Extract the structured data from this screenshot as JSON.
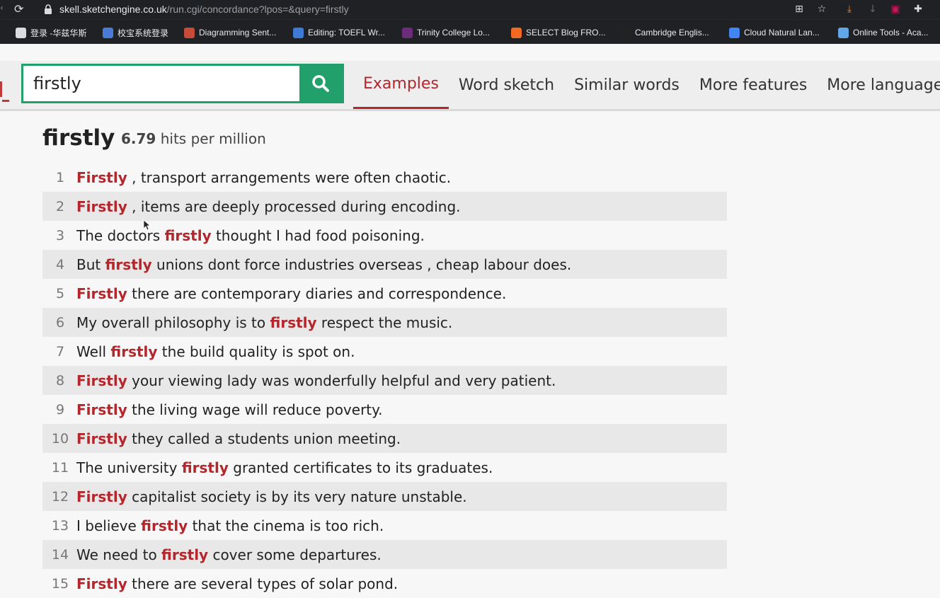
{
  "browser": {
    "url_host": "skell.sketchengine.co.uk",
    "url_path": "/run.cgi/concordance?lpos=&query=firstly",
    "bookmarks": [
      {
        "label": "登录 -华兹华斯",
        "icon": "globe-icon",
        "color": "#dadce0"
      },
      {
        "label": "校宝系统登录",
        "icon": "diamond-icon",
        "color": "#4a7bd6"
      },
      {
        "label": "Diagramming Sent...",
        "icon": "diagram-icon",
        "color": "#c84b3a"
      },
      {
        "label": "Editing: TOEFL Wr...",
        "icon": "edit-icon",
        "color": "#3d7bd6"
      },
      {
        "label": "Trinity College Lo...",
        "icon": "tr-icon",
        "color": "#6b2c7a"
      },
      {
        "label": "SELECT Blog FRO...",
        "icon": "blogger-icon",
        "color": "#f26a22"
      },
      {
        "label": "Cambridge Englis...",
        "icon": "ampersand-icon",
        "color": "#222222"
      },
      {
        "label": "Cloud Natural Lan...",
        "icon": "google-cloud-icon",
        "color": "#4285f4"
      },
      {
        "label": "Online Tools - Aca...",
        "icon": "cloud-icon",
        "color": "#62a8e8"
      }
    ]
  },
  "search": {
    "value": "firstly"
  },
  "tabs": [
    "Examples",
    "Word sketch",
    "Similar words",
    "More features",
    "More languages"
  ],
  "active_tab": "Examples",
  "headword": "firstly",
  "hits": {
    "value": "6.79",
    "unit": "hits per million"
  },
  "colors": {
    "accent": "#b3262b",
    "search_green": "#22a06b"
  },
  "results": [
    {
      "n": "1",
      "pre": "",
      "kw": "Firstly",
      "post": " , transport arrangements were often chaotic."
    },
    {
      "n": "2",
      "pre": "",
      "kw": "Firstly",
      "post": " , items are deeply processed during encoding."
    },
    {
      "n": "3",
      "pre": "The doctors ",
      "kw": "firstly",
      "post": " thought I had food poisoning."
    },
    {
      "n": "4",
      "pre": "But ",
      "kw": "firstly",
      "post": " unions dont force industries overseas , cheap labour does."
    },
    {
      "n": "5",
      "pre": "",
      "kw": "Firstly",
      "post": " there are contemporary diaries and correspondence."
    },
    {
      "n": "6",
      "pre": "My overall philosophy is to ",
      "kw": "firstly",
      "post": " respect the music."
    },
    {
      "n": "7",
      "pre": "Well ",
      "kw": "firstly",
      "post": " the build quality is spot on."
    },
    {
      "n": "8",
      "pre": "",
      "kw": "Firstly",
      "post": " your viewing lady was wonderfully helpful and very patient."
    },
    {
      "n": "9",
      "pre": "",
      "kw": "Firstly",
      "post": " the living wage will reduce poverty."
    },
    {
      "n": "10",
      "pre": "",
      "kw": "Firstly",
      "post": " they called a students union meeting."
    },
    {
      "n": "11",
      "pre": "The university ",
      "kw": "firstly",
      "post": " granted certificates to its graduates."
    },
    {
      "n": "12",
      "pre": "",
      "kw": "Firstly",
      "post": " capitalist society is by its very nature unstable."
    },
    {
      "n": "13",
      "pre": "I believe ",
      "kw": "firstly",
      "post": " that the cinema is too rich."
    },
    {
      "n": "14",
      "pre": "We need to ",
      "kw": "firstly",
      "post": " cover some departures."
    },
    {
      "n": "15",
      "pre": "",
      "kw": "Firstly",
      "post": " there are several types of solar pond."
    }
  ]
}
